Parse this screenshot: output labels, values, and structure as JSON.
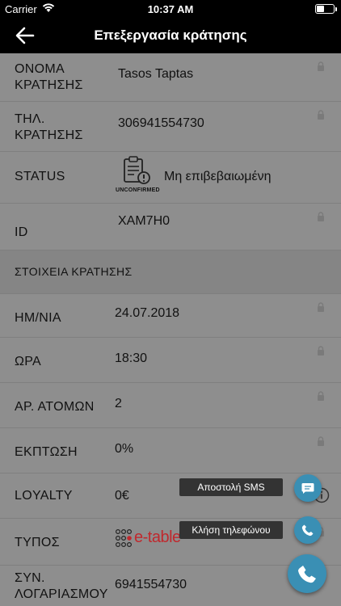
{
  "status_bar": {
    "carrier": "Carrier",
    "time": "10:37 AM"
  },
  "nav": {
    "title": "Επεξεργασία κράτησης",
    "back_icon": "arrow-left-icon"
  },
  "rows": {
    "name": {
      "label_line1": "ΟΝΟΜΑ",
      "label_line2": "ΚΡΑΤΗΣΗΣ",
      "value": "Tasos Taptas"
    },
    "phone": {
      "label_line1": "ΤΗΛ.",
      "label_line2": "ΚΡΑΤΗΣΗΣ",
      "value": "306941554730"
    },
    "status": {
      "label": "STATUS",
      "icon_caption": "UNCONFIRMED",
      "value": "Μη επιβεβαιωμένη"
    },
    "id": {
      "label": "ID",
      "value": "XAM7H0"
    }
  },
  "section": {
    "title": "ΣΤΟΙΧΕΙΑ ΚΡΑΤΗΣΗΣ"
  },
  "details": {
    "date": {
      "label": "ΗΜ/ΝΙΑ",
      "value": "24.07.2018"
    },
    "time": {
      "label": "ΩΡΑ",
      "value": "18:30"
    },
    "people": {
      "label": "ΑΡ. ΑΤΟΜΩΝ",
      "value": "2"
    },
    "discount": {
      "label": "ΕΚΠΤΩΣΗ",
      "value": "0%"
    },
    "loyalty": {
      "label": "LOYALTY",
      "value": "0€"
    },
    "type": {
      "label": "ΤΥΠΟΣ",
      "brand": "e-table"
    },
    "account": {
      "label_line1": "ΣΥΝ.",
      "label_line2": "ΛΟΓΑΡΙΑΣΜΟΥ",
      "value": "6941554730"
    }
  },
  "fab": {
    "sms_label": "Αποστολή SMS",
    "call_label": "Κλήση τηλεφώνου"
  },
  "colors": {
    "accent": "#3a8fb4",
    "overlay": "#8e8e8e",
    "bar": "#000000"
  }
}
